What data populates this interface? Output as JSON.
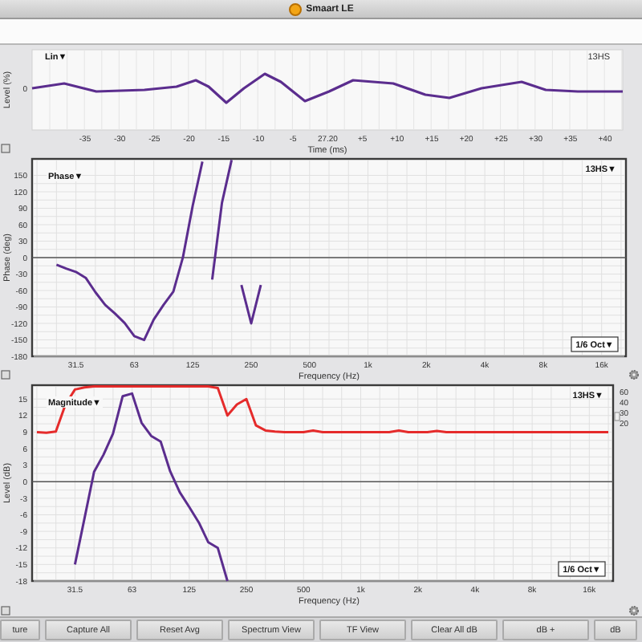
{
  "window": {
    "title": "Smaart LE"
  },
  "time_panel": {
    "mode": "Lin▼",
    "trace": "13HS",
    "ylabel": "Level (%)",
    "ytick": "0",
    "xlabel": "Time (ms)",
    "xticks": [
      "-35",
      "-30",
      "-25",
      "-20",
      "-15",
      "-10",
      "-5",
      "27.20",
      "+5",
      "+10",
      "+15",
      "+20",
      "+25",
      "+30",
      "+35",
      "+40"
    ]
  },
  "phase_panel": {
    "mode": "Phase▼",
    "trace": "13HS▼",
    "resolution": "1/6 Oct▼",
    "chart_data": {
      "type": "line",
      "grid": true,
      "xlabel": "Frequency (Hz)",
      "ylabel": "Phase (deg)",
      "ylim": [
        -180,
        180
      ],
      "yticks": [
        150,
        120,
        90,
        60,
        30,
        0,
        -30,
        -60,
        -90,
        -120,
        -150,
        -180
      ],
      "categories": [
        null,
        null,
        null,
        null,
        "31.5",
        null,
        null,
        null,
        null,
        null,
        "63",
        null,
        null,
        null,
        null,
        null,
        "125",
        null,
        null,
        null,
        null,
        null,
        "250",
        null,
        null,
        null,
        null,
        null,
        "500",
        null,
        null,
        null,
        null,
        null,
        "1k",
        null,
        null,
        null,
        null,
        null,
        "2k",
        null,
        null,
        null,
        null,
        null,
        "4k",
        null,
        null,
        null,
        null,
        null,
        "8k",
        null,
        null,
        null,
        null,
        null,
        "16k",
        null,
        null
      ],
      "series": [
        {
          "color": "#5b2d8e",
          "values": [
            null,
            null,
            -13,
            -20,
            -26,
            -37,
            -63,
            -86,
            -102,
            -119,
            -143,
            -150,
            -113,
            -86,
            -62,
            1,
            95,
            175,
            -40,
            100,
            178,
            -50,
            -120,
            -50,
            null,
            null,
            null,
            null,
            null,
            null,
            null,
            null,
            null,
            null,
            null,
            null,
            null,
            null,
            null,
            null,
            null,
            null,
            null,
            null,
            null,
            null,
            null,
            null,
            null,
            null,
            null,
            null,
            null,
            null,
            null,
            null,
            null,
            null,
            null,
            null,
            null
          ]
        }
      ]
    }
  },
  "magnitude_panel": {
    "mode": "Magnitude▼",
    "trace": "13HS▼",
    "resolution": "1/6 Oct▼",
    "right_scale": [
      "60",
      "40",
      "30",
      "20"
    ],
    "chart_data": {
      "type": "line",
      "grid": true,
      "xlabel": "Frequency (Hz)",
      "ylabel": "Level (dB)",
      "ylim": [
        -18,
        17.5
      ],
      "yticks": [
        15,
        12,
        9,
        6,
        3,
        0,
        -3,
        -6,
        -9,
        -12,
        -15,
        -18
      ],
      "categories": [
        null,
        null,
        null,
        null,
        "31.5",
        null,
        null,
        null,
        null,
        null,
        "63",
        null,
        null,
        null,
        null,
        null,
        "125",
        null,
        null,
        null,
        null,
        null,
        "250",
        null,
        null,
        null,
        null,
        null,
        "500",
        null,
        null,
        null,
        null,
        null,
        "1k",
        null,
        null,
        null,
        null,
        null,
        "2k",
        null,
        null,
        null,
        null,
        null,
        "4k",
        null,
        null,
        null,
        null,
        null,
        "8k",
        null,
        null,
        null,
        null,
        null,
        "16k",
        null,
        null
      ],
      "series": [
        {
          "color": "#e52b2b",
          "values": [
            9,
            8.9,
            9.1,
            14,
            16.7,
            17.1,
            17.3,
            17.3,
            17.3,
            17.3,
            17.3,
            17.3,
            17.3,
            17.3,
            17.3,
            17.3,
            17.3,
            17.3,
            17.3,
            17,
            12,
            14,
            15,
            10.2,
            9.3,
            9.1,
            9,
            9,
            9,
            9.3,
            9,
            9,
            9,
            9,
            9,
            9,
            9,
            9,
            9.3,
            9,
            9,
            9,
            9.2,
            9,
            9,
            9,
            9,
            9,
            9,
            9,
            9,
            9,
            9,
            9,
            9,
            9,
            9,
            9,
            9,
            9,
            9
          ]
        },
        {
          "color": "#5b2d8e",
          "values": [
            null,
            null,
            null,
            null,
            -15,
            -6.7,
            1.8,
            4.9,
            8.7,
            15.5,
            16,
            10.7,
            8.3,
            7.3,
            1.9,
            -1.9,
            -4.6,
            -7.4,
            -11,
            -12,
            -18,
            null,
            null,
            null,
            null,
            null,
            null,
            null,
            null,
            null,
            null,
            null,
            null,
            null,
            null,
            null,
            null,
            null,
            null,
            null,
            null,
            null,
            null,
            null,
            null,
            null,
            null,
            null,
            null,
            null,
            null,
            null,
            null,
            null,
            null,
            null,
            null,
            null,
            null,
            null,
            null
          ]
        }
      ]
    }
  },
  "buttons": [
    "ture",
    "Capture All",
    "Reset Avg",
    "Spectrum View",
    "TF View",
    "Clear All dB",
    "dB +",
    "dB"
  ]
}
